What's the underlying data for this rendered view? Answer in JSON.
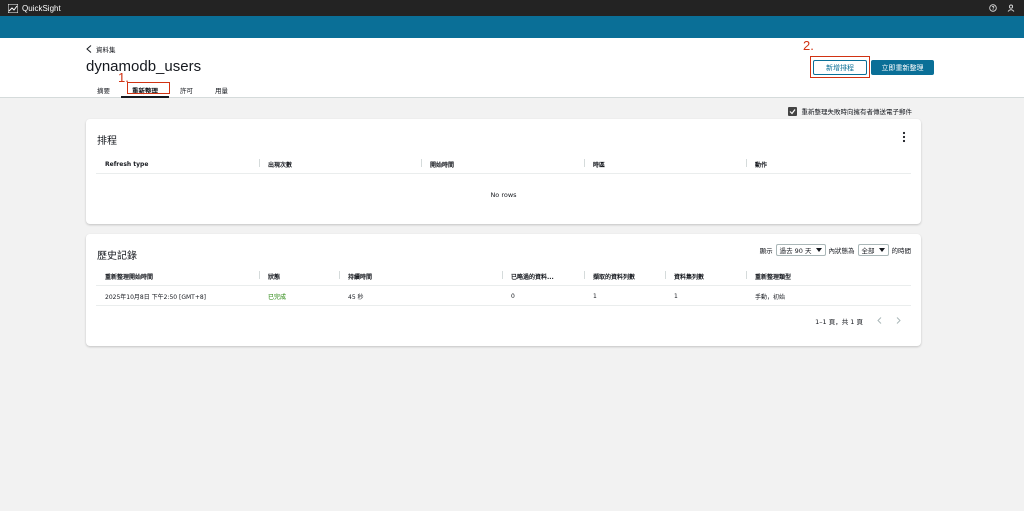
{
  "topbar": {
    "app_name": "QuickSight",
    "icons": [
      "help-icon",
      "user-icon"
    ]
  },
  "header": {
    "back_label": "資料集",
    "title": "dynamodb_users",
    "tabs": [
      {
        "label": "摘要"
      },
      {
        "label": "重新整理"
      },
      {
        "label": "許可"
      },
      {
        "label": "用量"
      }
    ],
    "add_schedule_label": "新增排程",
    "refresh_now_label": "立即重新整理"
  },
  "annotations": {
    "step1": "1.",
    "step2": "2."
  },
  "email_option": {
    "label": "重新整理失敗時向擁有者傳送電子郵件",
    "checked": true
  },
  "schedule": {
    "title": "排程",
    "columns": [
      "Refresh type",
      "出現次數",
      "開始時間",
      "時區",
      "動作"
    ],
    "empty_text": "No rows"
  },
  "history": {
    "title": "歷史記錄",
    "filter": {
      "show_label": "顯示",
      "range_value": "過去 90 天",
      "status_label": "內狀態為",
      "status_value": "全部",
      "suffix": "的時間"
    },
    "columns": [
      "重新整理開始時間",
      "狀態",
      "持續時間",
      "已略過的資料...",
      "擷取的資料列數",
      "資料集列數",
      "重新整理類型"
    ],
    "rows": [
      [
        "2025年10月8日 下午2:50 [GMT+8]",
        "已完成",
        "45 秒",
        "0",
        "1",
        "1",
        "手動，初始"
      ]
    ],
    "pagination": "1–1 頁，共 1 頁"
  },
  "colors": {
    "accent": "#0a6f97",
    "success": "#1d8102",
    "annotation": "#d13212"
  }
}
